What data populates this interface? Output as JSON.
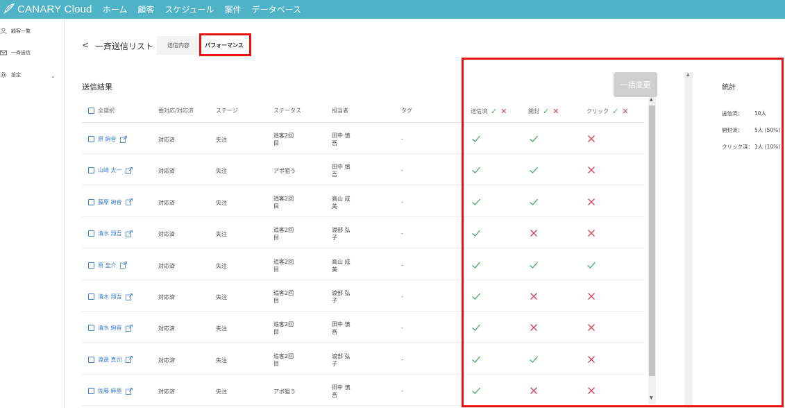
{
  "header": {
    "logo_text": "CANARY Cloud",
    "nav": [
      "ホーム",
      "顧客",
      "スケジュール",
      "案件",
      "データベース"
    ],
    "brand_color": "#4fb3c8"
  },
  "sidebar": {
    "items": [
      {
        "label": "顧客一覧",
        "icon": "user-icon"
      },
      {
        "label": "一斉送信",
        "icon": "mail-icon"
      },
      {
        "label": "設定",
        "icon": "gear-icon"
      }
    ]
  },
  "breadcrumb": {
    "back": "<",
    "title": "一斉送信リスト"
  },
  "tabs": [
    {
      "label": "送信内容",
      "active": false
    },
    {
      "label": "パフォーマンス",
      "active": true
    }
  ],
  "section_title": "送信結果",
  "bulk_button": "一括変更",
  "table": {
    "columns": [
      "全選択",
      "要対応/対応済",
      "ステージ",
      "ステータス",
      "担当者",
      "タグ",
      "送信済",
      "開封",
      "クリック"
    ],
    "rows": [
      {
        "name": "原 絢音",
        "resp": "対応済",
        "stage": "失注",
        "status": "追客2回目",
        "owner": "田中 慎吾",
        "tag": "-",
        "sent": true,
        "opened": true,
        "clicked": false
      },
      {
        "name": "山崎 太一",
        "resp": "対応済",
        "stage": "失注",
        "status": "アポ狙う",
        "owner": "田中 慎吾",
        "tag": "-",
        "sent": true,
        "opened": true,
        "clicked": false
      },
      {
        "name": "藤原 絢音",
        "resp": "対応済",
        "stage": "失注",
        "status": "追客2回目",
        "owner": "高山 成美",
        "tag": "-",
        "sent": true,
        "opened": true,
        "clicked": false
      },
      {
        "name": "清水 翔吾",
        "resp": "対応済",
        "stage": "失注",
        "status": "追客2回目",
        "owner": "渡部 弘子",
        "tag": "-",
        "sent": true,
        "opened": false,
        "clicked": false
      },
      {
        "name": "原 圭介",
        "resp": "対応済",
        "stage": "失注",
        "status": "追客2回目",
        "owner": "高山 成美",
        "tag": "-",
        "sent": true,
        "opened": true,
        "clicked": true
      },
      {
        "name": "清水 翔吾",
        "resp": "対応済",
        "stage": "失注",
        "status": "追客2回目",
        "owner": "渡部 弘子",
        "tag": "-",
        "sent": true,
        "opened": false,
        "clicked": false
      },
      {
        "name": "清水 絢音",
        "resp": "対応済",
        "stage": "失注",
        "status": "追客2回目",
        "owner": "田中 慎吾",
        "tag": "-",
        "sent": true,
        "opened": false,
        "clicked": false
      },
      {
        "name": "渡邊 真司",
        "resp": "対応済",
        "stage": "失注",
        "status": "追客2回目",
        "owner": "渡部 弘子",
        "tag": "-",
        "sent": true,
        "opened": true,
        "clicked": false
      },
      {
        "name": "佐藤 麻里",
        "resp": "対応済",
        "stage": "失注",
        "status": "アポ狙う",
        "owner": "田中 慎吾",
        "tag": "-",
        "sent": true,
        "opened": false,
        "clicked": false
      }
    ]
  },
  "stats": {
    "title": "統計",
    "items": [
      {
        "label": "送信済：",
        "value": "10人"
      },
      {
        "label": "開封済：",
        "value": "5人 (50%)"
      },
      {
        "label": "クリック済：",
        "value": "1人 (10%)"
      }
    ]
  },
  "colors": {
    "check": "#3fae5a",
    "cross": "#d63c5a",
    "link": "#3a7fd5",
    "highlight": "#ee1111"
  }
}
